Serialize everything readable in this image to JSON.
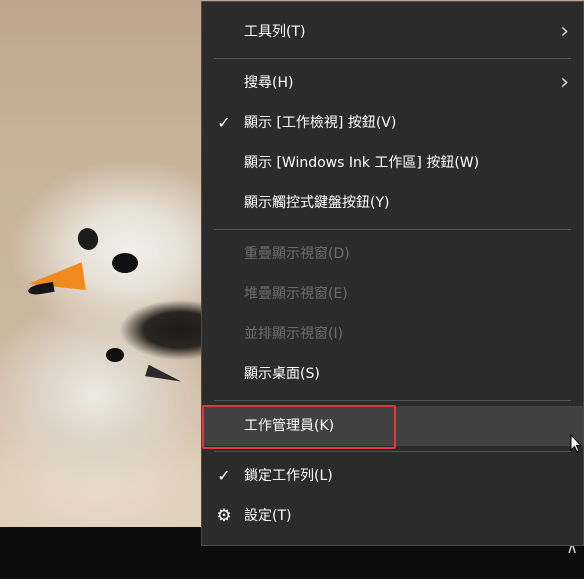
{
  "menu": {
    "items": [
      {
        "label": "工具列(T)",
        "check": false,
        "submenu": true,
        "disabled": false
      },
      {
        "label": "搜尋(H)",
        "check": false,
        "submenu": true,
        "disabled": false
      },
      {
        "label": "顯示 [工作檢視] 按鈕(V)",
        "check": true,
        "submenu": false,
        "disabled": false
      },
      {
        "label": "顯示 [Windows Ink 工作區] 按鈕(W)",
        "check": false,
        "submenu": false,
        "disabled": false
      },
      {
        "label": "顯示觸控式鍵盤按鈕(Y)",
        "check": false,
        "submenu": false,
        "disabled": false
      },
      {
        "label": "重疊顯示視窗(D)",
        "check": false,
        "submenu": false,
        "disabled": true
      },
      {
        "label": "堆疊顯示視窗(E)",
        "check": false,
        "submenu": false,
        "disabled": true
      },
      {
        "label": "並排顯示視窗(I)",
        "check": false,
        "submenu": false,
        "disabled": true
      },
      {
        "label": "顯示桌面(S)",
        "check": false,
        "submenu": false,
        "disabled": false
      },
      {
        "label": "工作管理員(K)",
        "check": false,
        "submenu": false,
        "disabled": false,
        "hover": true
      },
      {
        "label": "鎖定工作列(L)",
        "check": true,
        "submenu": false,
        "disabled": false
      },
      {
        "label": "設定(T)",
        "check": false,
        "submenu": false,
        "disabled": false,
        "icon": "gear-icon"
      }
    ],
    "glyphs": {
      "check": "✓",
      "chevron": "›",
      "gear": "⚙",
      "tray": "∧"
    }
  },
  "colors": {
    "menu_bg": "#2b2b2b",
    "hover_bg": "#414141",
    "highlight": "#e0373f",
    "text": "#ffffff",
    "disabled_text": "#6d6d6d"
  }
}
